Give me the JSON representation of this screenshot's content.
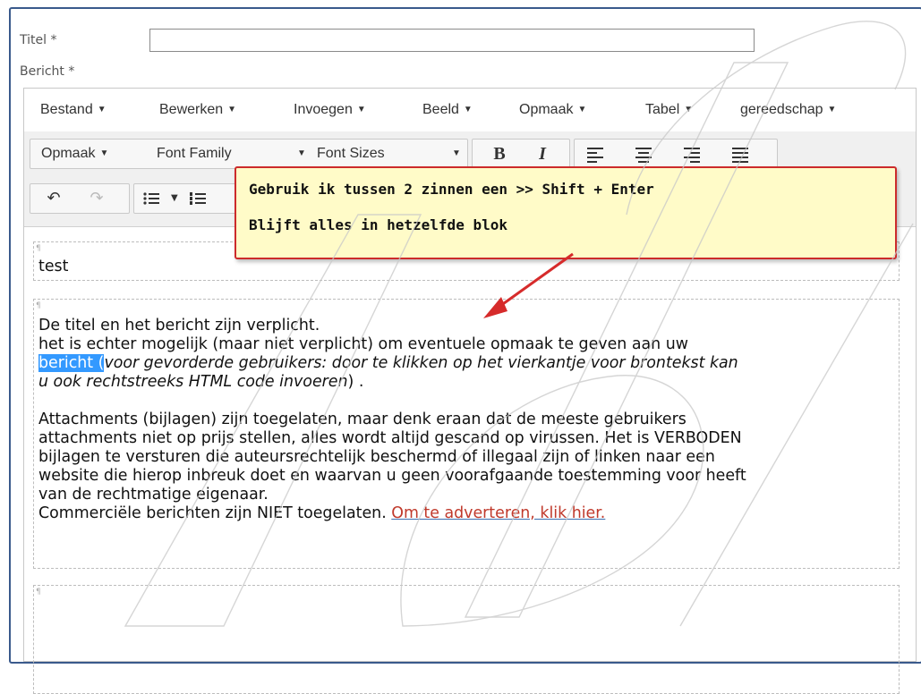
{
  "form": {
    "title_label": "Titel *",
    "title_value": "",
    "message_label": "Bericht *"
  },
  "menubar": {
    "items": [
      "Bestand",
      "Bewerken",
      "Invoegen",
      "Beeld",
      "Opmaak",
      "Tabel",
      "gereedschap"
    ]
  },
  "toolbar": {
    "format_label": "Opmaak",
    "font_family_label": "Font Family",
    "font_sizes_label": "Font Sizes",
    "bold_label": "B",
    "italic_label": "I"
  },
  "callout": {
    "line1": "Gebruik ik tussen 2 zinnen een >> Shift + Enter",
    "line2": "Blijft alles in hetzelfde blok",
    "border_color": "#cc2b2b",
    "background_color": "#fffbc8"
  },
  "content": {
    "block1_text": "test",
    "block2": {
      "line1": "De titel en het bericht zijn verplicht.",
      "line2": "het is echter mogelijk (maar niet verplicht) om eventuele opmaak te geven aan uw",
      "line3_highlight": "bericht (",
      "line3_italic": "voor gevorderde gebruikers: door te klikken op het vierkantje voor brontekst kan",
      "line4_italic": "u ook rechtstreeks HTML code invoeren",
      "line4_end": ") .",
      "line6": "Attachments (bijlagen) zijn toegelaten, maar denk eraan dat de meeste gebruikers",
      "line7": "attachments niet op prijs stellen, alles wordt altijd gescand op virussen. Het is VERBODEN",
      "line8": "bijlagen te versturen die auteursrechtelijk beschermd of illegaal zijn of linken naar een",
      "line9": "website die hierop inbreuk doet en waarvan u geen voorafgaande toestemming voor heeft",
      "line10": "van de rechtmatige eigenaar.",
      "line11_text": "Commerciële berichten zijn NIET toegelaten. ",
      "line11_link": "Om te adverteren, klik hier."
    },
    "block_marker": "¶",
    "highlight_color": "#3399ff",
    "link_color": "#c0392b"
  }
}
